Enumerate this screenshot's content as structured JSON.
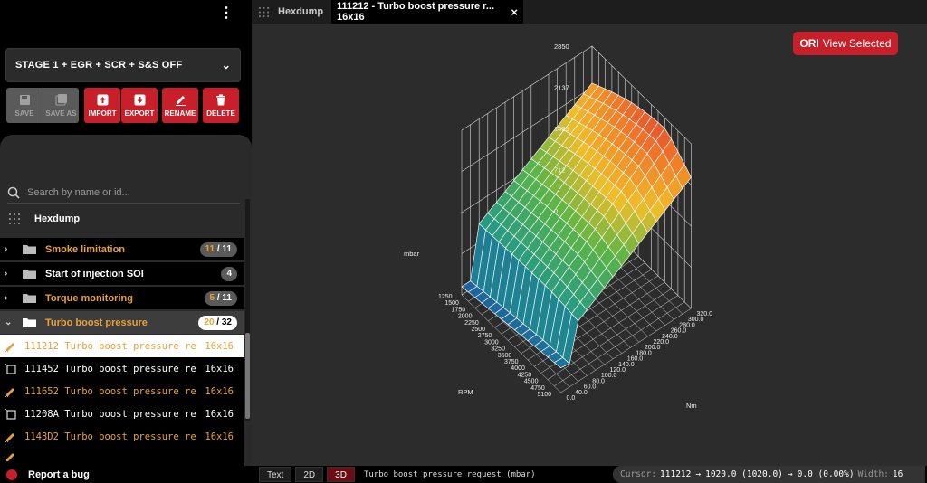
{
  "sidebar": {
    "menu_icon": "kebab-menu-icon",
    "preset": {
      "label": "STAGE 1 + EGR + SCR + S&S OFF",
      "icon": "chevron-down-icon"
    },
    "toolbar": {
      "save": "SAVE",
      "save_as": "SAVE AS",
      "import": "IMPORT",
      "export": "EXPORT",
      "rename": "RENAME",
      "delete": "DELETE"
    },
    "search": {
      "placeholder": "Search by name or id..."
    },
    "hexdump": {
      "label": "Hexdump"
    },
    "categories": [
      {
        "label": "Smoke limitation",
        "count": "11",
        "total": "11",
        "modified": true
      },
      {
        "label": "Start of injection SOI",
        "count": "4",
        "modified": false
      },
      {
        "label": "Torque monitoring",
        "count": "5",
        "total": "11",
        "modified": true
      },
      {
        "label": "Turbo boost pressure",
        "count": "20",
        "total": "32",
        "modified": true,
        "expanded": true
      }
    ],
    "maps": [
      {
        "name": "111212 Turbo boost pressure requ",
        "dim": "16x16",
        "modified": true,
        "active": true
      },
      {
        "name": "111452 Turbo boost pressure requ",
        "dim": "16x16",
        "modified": false
      },
      {
        "name": "111652 Turbo boost pressure requ",
        "dim": "16x16",
        "modified": true
      },
      {
        "name": "11208A Turbo boost pressure requ",
        "dim": "16x16",
        "modified": false
      },
      {
        "name": "1143D2 Turbo boost pressure requ",
        "dim": "16x16",
        "modified": true
      }
    ],
    "report_bug": "Report a bug"
  },
  "tabs": [
    {
      "label": "Hexdump",
      "icon": "grid-icon"
    },
    {
      "label": "111212 - Turbo boost pressure r... 16x16",
      "close": "×"
    }
  ],
  "viewer": {
    "ori_label": "ORI",
    "ori_text": "View Selected",
    "zlabel": "mbar",
    "xlabel": "RPM",
    "ylabel": "Nm",
    "z_ticks": [
      "2850",
      "2137",
      "1425",
      "712",
      "0"
    ],
    "rpm_ticks": [
      "1250",
      "1500",
      "1750",
      "2000",
      "2250",
      "2500",
      "2750",
      "3000",
      "3250",
      "3500",
      "3750",
      "4000",
      "4250",
      "4500",
      "4750",
      "5100"
    ],
    "nm_ticks": [
      "0.0",
      "40.0",
      "60.0",
      "80.0",
      "100.0",
      "120.0",
      "140.0",
      "160.0",
      "180.0",
      "200.0",
      "220.0",
      "240.0",
      "260.0",
      "280.0",
      "300.0",
      "320.0"
    ]
  },
  "statusbar": {
    "views": [
      "Text",
      "2D",
      "3D"
    ],
    "active_view": "3D",
    "map_label": "Turbo boost pressure request (mbar)",
    "cursor_label": "Cursor:",
    "cursor_addr": "111212",
    "arrow": "→",
    "value": "1020.0 (1020.0)",
    "delta": "0.0 (0.00%)",
    "width_label": "Width:",
    "width_value": "16"
  },
  "colors": {
    "accent": "#c8202a",
    "modified": "#e8a13a"
  }
}
